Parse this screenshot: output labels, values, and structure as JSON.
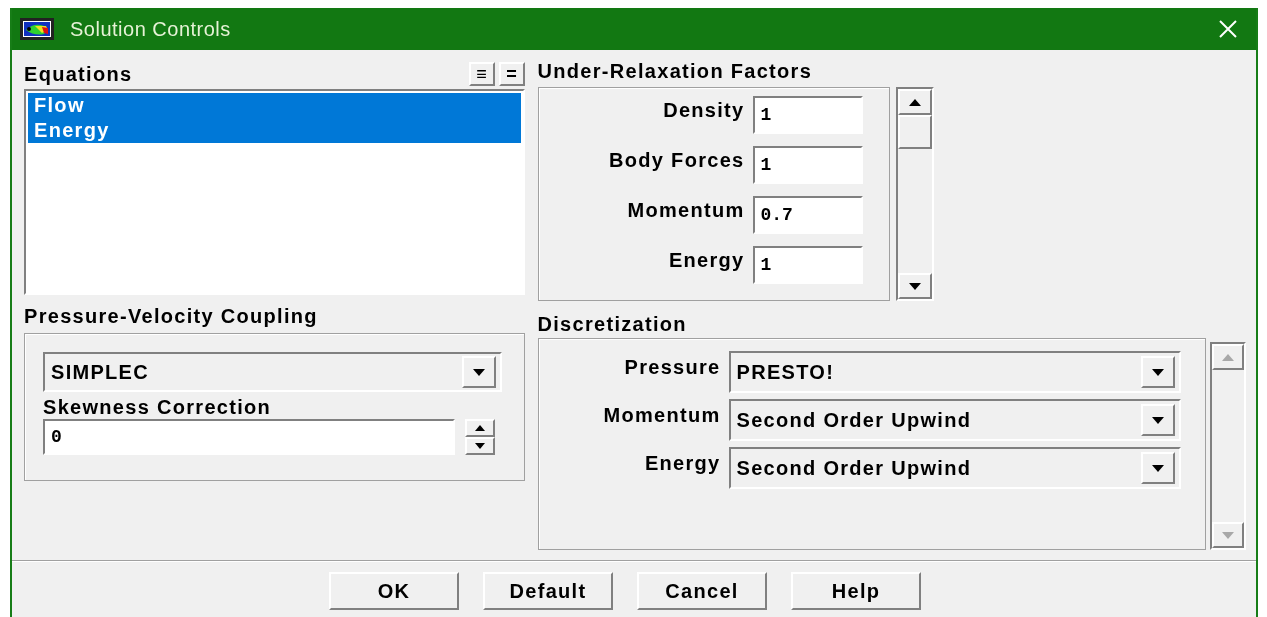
{
  "window": {
    "title": "Solution Controls"
  },
  "equations": {
    "label": "Equations",
    "view_buttons": [
      "≡",
      "="
    ],
    "items": [
      {
        "label": "Flow",
        "selected": true
      },
      {
        "label": "Energy",
        "selected": true
      }
    ]
  },
  "under_relaxation": {
    "label": "Under-Relaxation Factors",
    "factors": [
      {
        "label": "Density",
        "value": "1"
      },
      {
        "label": "Body Forces",
        "value": "1"
      },
      {
        "label": "Momentum",
        "value": "0.7"
      },
      {
        "label": "Energy",
        "value": "1"
      }
    ]
  },
  "pressure_velocity_coupling": {
    "label": "Pressure-Velocity Coupling",
    "scheme": "SIMPLEC",
    "skewness_label": "Skewness Correction",
    "skewness_value": "0"
  },
  "discretization": {
    "label": "Discretization",
    "rows": [
      {
        "label": "Pressure",
        "value": "PRESTO!"
      },
      {
        "label": "Momentum",
        "value": "Second Order Upwind"
      },
      {
        "label": "Energy",
        "value": "Second Order Upwind"
      }
    ]
  },
  "buttons": [
    "OK",
    "Default",
    "Cancel",
    "Help"
  ]
}
